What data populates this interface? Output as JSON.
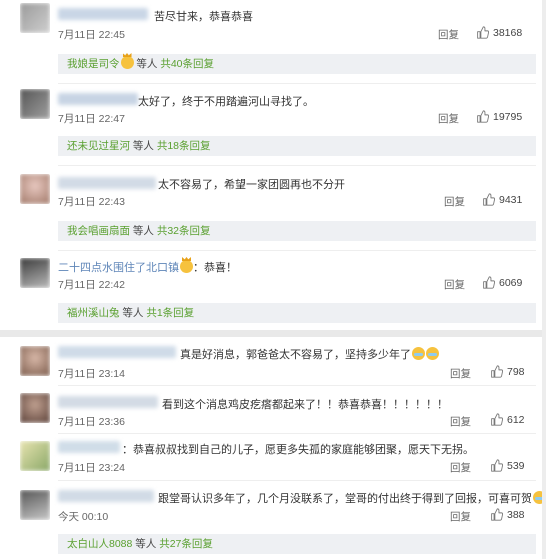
{
  "comments_top": [
    {
      "text": "苦尽甘来，恭喜恭喜",
      "time": "7月11日 22:45",
      "reply": "回复",
      "likes": "38168",
      "subreplies": {
        "first_user": "我娘是司令",
        "mid": "等人",
        "count": "共40条回复"
      }
    },
    {
      "text": "太好了，终于不用踏遍河山寻找了。",
      "time": "7月11日 22:47",
      "reply": "回复",
      "likes": "19795",
      "subreplies": {
        "first_user": "还未见过星河",
        "mid": "等人",
        "count": "共18条回复"
      }
    },
    {
      "text": "太不容易了，希望一家团圆再也不分开",
      "time": "7月11日 22:43",
      "reply": "回复",
      "likes": "9431",
      "subreplies": {
        "first_user": "我会唱画扇面",
        "mid": "等人",
        "count": "共32条回复"
      }
    },
    {
      "user": "二十四点水围住了北口镇",
      "text": "：恭喜！",
      "time": "7月11日 22:42",
      "reply": "回复",
      "likes": "6069",
      "subreplies": {
        "first_user": "福州溪山兔",
        "mid": "等人",
        "count": "共1条回复"
      }
    }
  ],
  "comments_bottom": [
    {
      "text": "真是好消息，郭爸爸太不容易了，坚持多少年了",
      "time": "7月11日 23:14",
      "reply": "回复",
      "likes": "798"
    },
    {
      "text": "看到这个消息鸡皮疙瘩都起来了！！恭喜恭喜！！！！！！",
      "time": "7月11日 23:36",
      "reply": "回复",
      "likes": "612"
    },
    {
      "text": "：恭喜叔叔找到自己的儿子，愿更多失孤的家庭能够团聚，愿天下无拐。",
      "time": "7月11日 23:24",
      "reply": "回复",
      "likes": "539"
    },
    {
      "text": "跟堂哥认识多年了，几个月没联系了，堂哥的付出终于得到了回报，可喜可贺",
      "time": "今天 00:10",
      "reply": "回复",
      "likes": "388",
      "subreplies": {
        "first_user": "太白山人8088",
        "mid": "等人",
        "count": "共27条回复"
      }
    }
  ],
  "icons": {
    "like": "thumbs-up-icon",
    "emoji_crown": "crown-emoji-icon",
    "emoji_cry": "crying-laugh-emoji-icon"
  },
  "colors": {
    "link_blue": "#5f86b8",
    "reply_green": "#5aa030",
    "subbox_bg": "#eef0f3",
    "separator": "#e9e9e9"
  }
}
